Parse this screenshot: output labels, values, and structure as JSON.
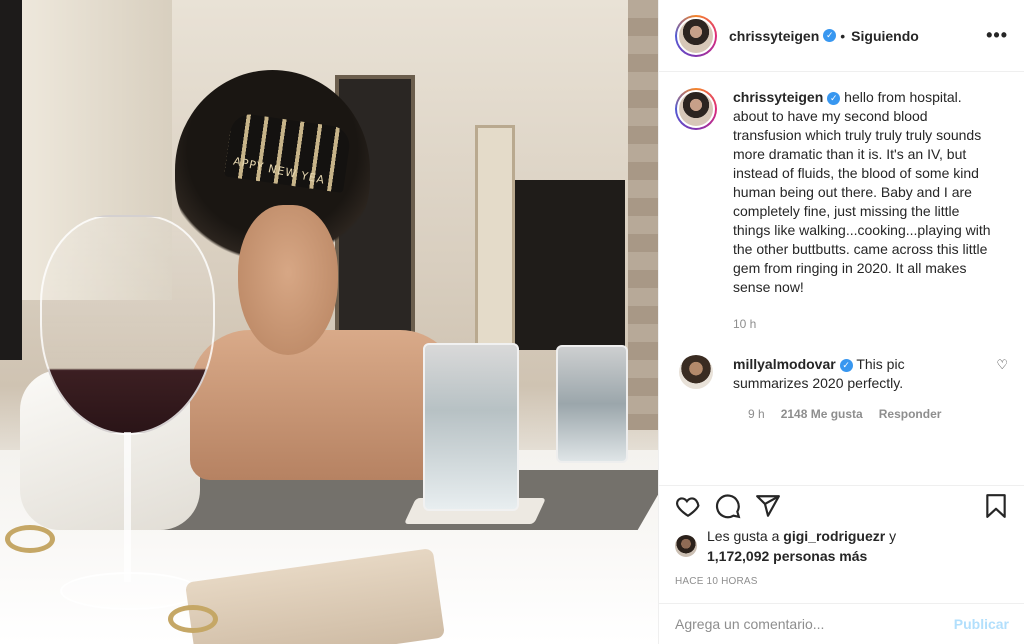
{
  "photo": {
    "crown_text": "APPY NEW YEA",
    "alt": ""
  },
  "header": {
    "username": "chrissyteigen",
    "verified_mark": "✓",
    "separator": "•",
    "follow_status": "Siguiendo",
    "more_label": "•••"
  },
  "caption": {
    "username": "chrissyteigen",
    "text": " hello from hospital. about to have my second blood transfusion which truly truly truly sounds more dramatic than it is. It's an IV, but instead of fluids, the blood of some kind human being out there. Baby and I are completely fine, just missing the little things like walking...cooking...playing with the other buttbutts. came across this little gem from ringing in 2020. It all makes sense now!",
    "time": "10 h"
  },
  "comment": {
    "username": "millyalmodovar",
    "text": " This pic summarizes 2020 perfectly.",
    "time": "9 h",
    "likes": "2148 Me gusta",
    "reply": "Responder",
    "heart": "♡"
  },
  "likes": {
    "prefix": "Les gusta a ",
    "user": "gigi_rodriguezr",
    "middle": " y",
    "count": "1,172,092 personas más"
  },
  "post_time": "HACE 10 HORAS",
  "add_comment": {
    "placeholder": "Agrega un comentario...",
    "publish": "Publicar"
  },
  "icons": [
    "heart-icon",
    "comment-icon",
    "share-icon",
    "bookmark-icon"
  ],
  "colors": {
    "verified": "#3897f0",
    "publish_disabled": "#b2dffc",
    "muted": "#8e8e8e"
  }
}
